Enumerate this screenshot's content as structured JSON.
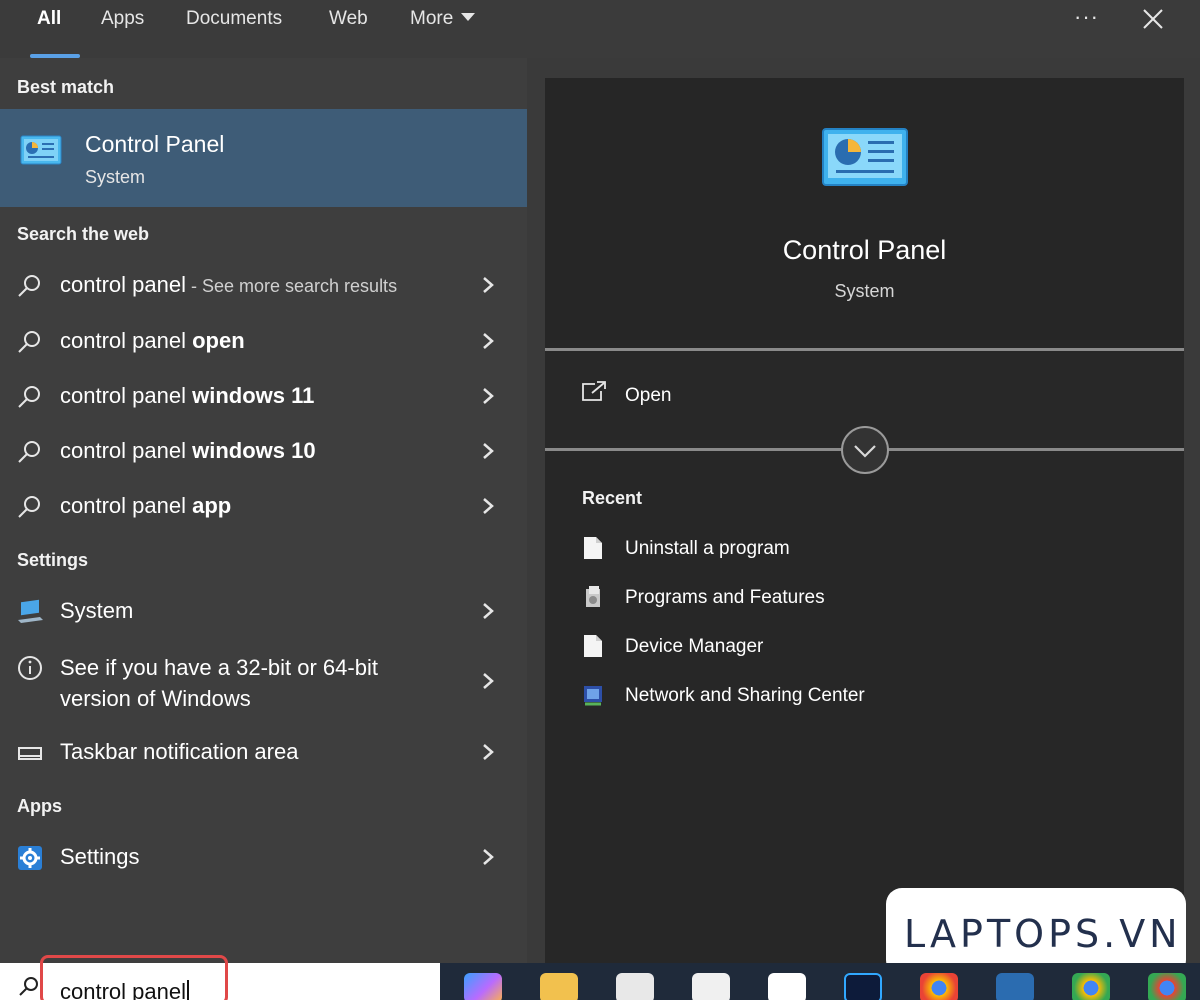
{
  "tabs": [
    {
      "label": "All",
      "active": true
    },
    {
      "label": "Apps"
    },
    {
      "label": "Documents"
    },
    {
      "label": "Web"
    },
    {
      "label": "More"
    }
  ],
  "header_controls": {
    "more_options_icon": "ellipsis-icon",
    "close_icon": "close-icon"
  },
  "left": {
    "best_match_header": "Best match",
    "best_match": {
      "title": "Control Panel",
      "subtitle": "System",
      "icon": "control-panel-icon"
    },
    "web_header": "Search the web",
    "web_results": [
      {
        "prefix": "control panel",
        "bold": "",
        "hint": " - See more search results"
      },
      {
        "prefix": "control panel ",
        "bold": "open",
        "hint": ""
      },
      {
        "prefix": "control panel ",
        "bold": "windows 11",
        "hint": ""
      },
      {
        "prefix": "control panel ",
        "bold": "windows 10",
        "hint": ""
      },
      {
        "prefix": "control panel ",
        "bold": "app",
        "hint": ""
      }
    ],
    "settings_header": "Settings",
    "settings_results": [
      {
        "label": "System",
        "icon": "laptop-icon"
      },
      {
        "label_line1": "See if you have a 32-bit or 64-bit",
        "label_line2": "version of Windows",
        "icon": "info-icon"
      },
      {
        "label": "Taskbar notification area",
        "icon": "taskbar-icon"
      }
    ],
    "apps_header": "Apps",
    "apps_results": [
      {
        "label": "Settings",
        "icon": "gear-icon"
      }
    ]
  },
  "right": {
    "title": "Control Panel",
    "subtitle": "System",
    "open_label": "Open",
    "recent_header": "Recent",
    "recent_items": [
      {
        "label": "Uninstall a program",
        "icon": "document-icon"
      },
      {
        "label": "Programs and Features",
        "icon": "programs-icon"
      },
      {
        "label": "Device Manager",
        "icon": "document-icon"
      },
      {
        "label": "Network and Sharing Center",
        "icon": "network-icon"
      }
    ]
  },
  "watermark": {
    "text": "LAPTOPS.VN"
  },
  "taskbar": {
    "search_value": "control panel",
    "apps": [
      "copilot-icon",
      "file-explorer-icon",
      "microsoft-store-icon",
      "app-icon",
      "zalo-icon",
      "photoshop-icon",
      "chrome-icon",
      "app-icon",
      "chrome-icon",
      "chrome-icon"
    ]
  },
  "colors": {
    "accent": "#5aa0e6",
    "selected_row": "#3e5c77",
    "highlight_border": "#e04848"
  }
}
